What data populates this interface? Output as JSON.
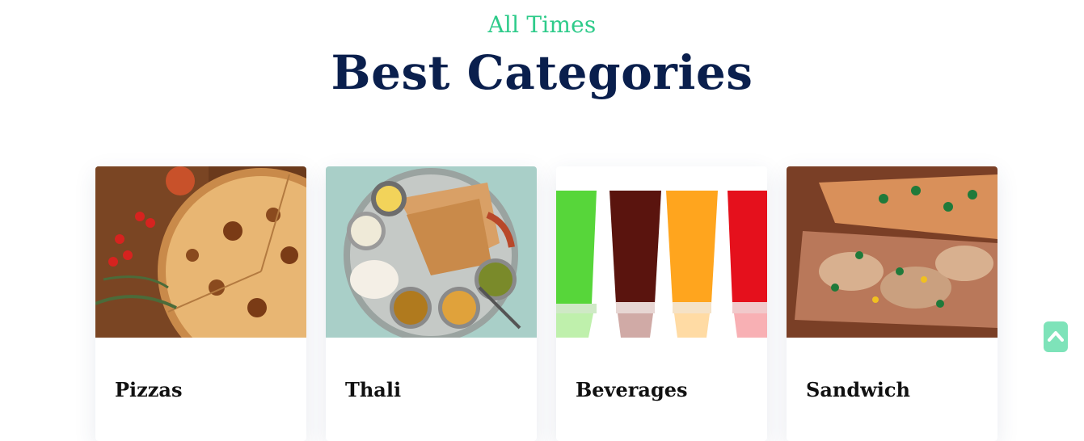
{
  "header": {
    "eyebrow": "All Times",
    "title": "Best Categories"
  },
  "categories": [
    {
      "label": "Pizzas",
      "icon": "pizza-image"
    },
    {
      "label": "Thali",
      "icon": "thali-image"
    },
    {
      "label": "Beverages",
      "icon": "beverages-image"
    },
    {
      "label": "Sandwich",
      "icon": "sandwich-image"
    }
  ],
  "colors": {
    "accent": "#2ecb8a",
    "title": "#0a1f4d",
    "scroll_button": "#7ee3b9"
  },
  "scroll_top": {
    "icon": "chevron-up-icon"
  }
}
